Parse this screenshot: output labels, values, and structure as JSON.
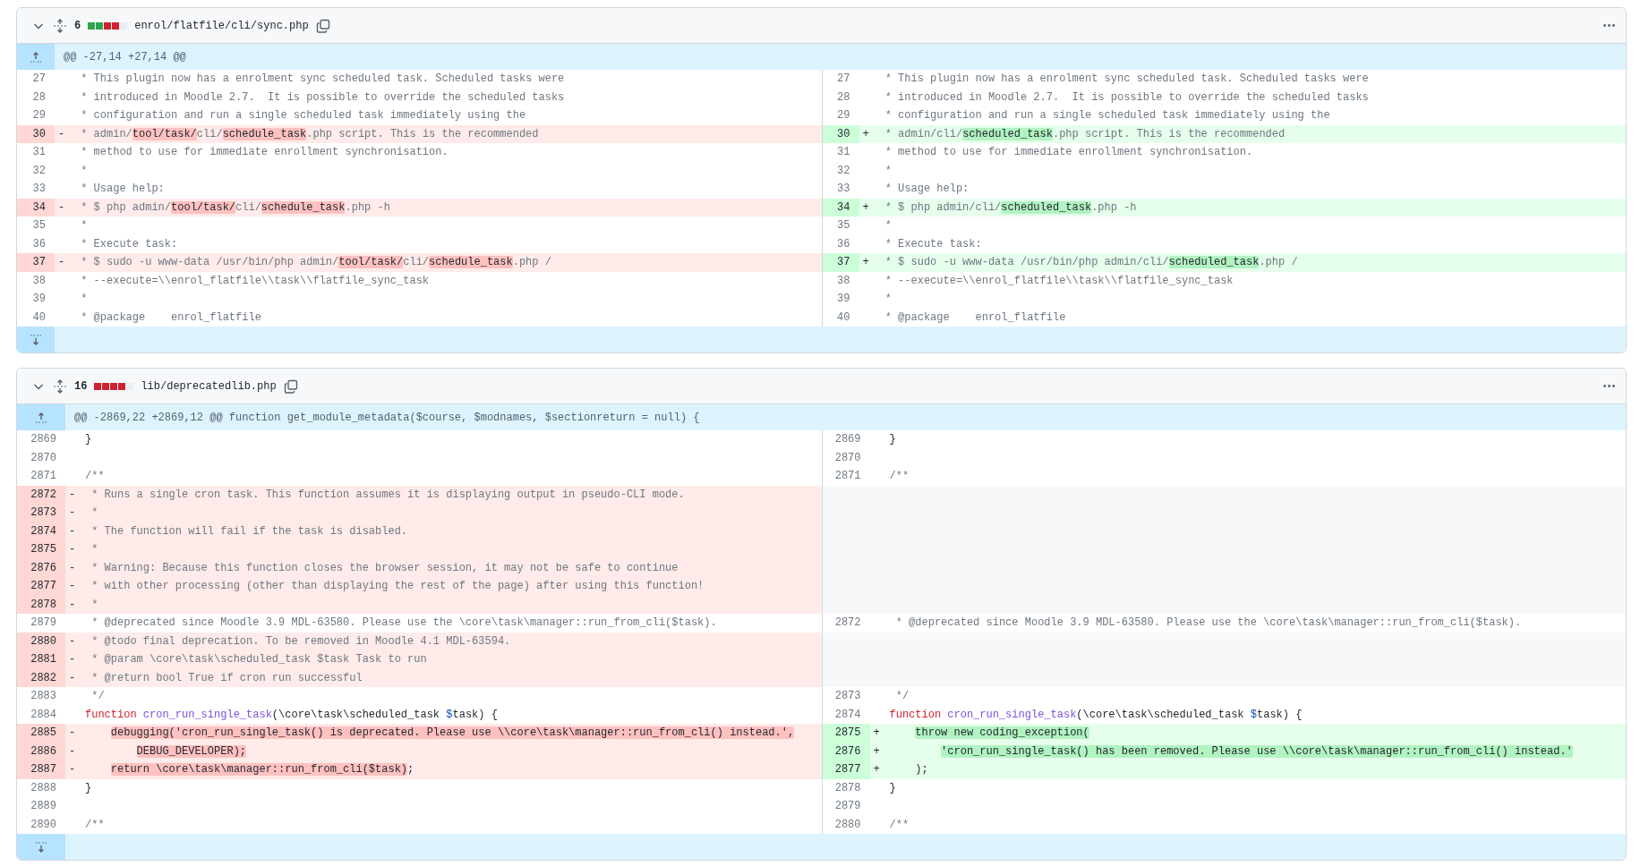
{
  "files": [
    {
      "expanded": true,
      "changes": "6",
      "diffstat": [
        {
          "color": "#2da44e"
        },
        {
          "color": "#2da44e"
        },
        {
          "color": "#cf222e"
        },
        {
          "color": "#cf222e"
        },
        {
          "color": "#eaeef2"
        }
      ],
      "path": "enrol/flatfile/cli/sync.php",
      "hunk": "@@ -27,14 +27,14 @@",
      "rows": [
        {
          "left": {
            "kind": "context",
            "num": "27",
            "segs": [
              {
                "text": " * This plugin now has a enrolment sync scheduled task. Scheduled tasks were",
                "kind": "comment",
                "highlight": false
              }
            ]
          },
          "right": {
            "kind": "context",
            "num": "27",
            "segs": [
              {
                "text": " * This plugin now has a enrolment sync scheduled task. Scheduled tasks were",
                "kind": "comment",
                "highlight": false
              }
            ]
          }
        },
        {
          "left": {
            "kind": "context",
            "num": "28",
            "segs": [
              {
                "text": " * introduced in Moodle 2.7.  It is possible to override the scheduled tasks",
                "kind": "comment",
                "highlight": false
              }
            ]
          },
          "right": {
            "kind": "context",
            "num": "28",
            "segs": [
              {
                "text": " * introduced in Moodle 2.7.  It is possible to override the scheduled tasks",
                "kind": "comment",
                "highlight": false
              }
            ]
          }
        },
        {
          "left": {
            "kind": "context",
            "num": "29",
            "segs": [
              {
                "text": " * configuration and run a single scheduled task immediately using the",
                "kind": "comment",
                "highlight": false
              }
            ]
          },
          "right": {
            "kind": "context",
            "num": "29",
            "segs": [
              {
                "text": " * configuration and run a single scheduled task immediately using the",
                "kind": "comment",
                "highlight": false
              }
            ]
          }
        },
        {
          "left": {
            "kind": "deletion",
            "num": "30",
            "marker": "-",
            "segs": [
              {
                "text": " * admin/",
                "kind": "comment",
                "highlight": false
              },
              {
                "text": "tool/task/",
                "kind": "comment",
                "highlight": true
              },
              {
                "text": "cli/",
                "kind": "comment",
                "highlight": false
              },
              {
                "text": "schedule_task",
                "kind": "comment",
                "highlight": true
              },
              {
                "text": ".php script. This is the recommended",
                "kind": "comment",
                "highlight": false
              }
            ]
          },
          "right": {
            "kind": "addition",
            "num": "30",
            "marker": "+",
            "segs": [
              {
                "text": " * admin/cli/",
                "kind": "comment",
                "highlight": false
              },
              {
                "text": "scheduled_task",
                "kind": "comment",
                "highlight": true
              },
              {
                "text": ".php script. This is the recommended",
                "kind": "comment",
                "highlight": false
              }
            ]
          }
        },
        {
          "left": {
            "kind": "context",
            "num": "31",
            "segs": [
              {
                "text": " * method to use for immediate enrollment synchronisation.",
                "kind": "comment",
                "highlight": false
              }
            ]
          },
          "right": {
            "kind": "context",
            "num": "31",
            "segs": [
              {
                "text": " * method to use for immediate enrollment synchronisation.",
                "kind": "comment",
                "highlight": false
              }
            ]
          }
        },
        {
          "left": {
            "kind": "context",
            "num": "32",
            "segs": [
              {
                "text": " *",
                "kind": "comment",
                "highlight": false
              }
            ]
          },
          "right": {
            "kind": "context",
            "num": "32",
            "segs": [
              {
                "text": " *",
                "kind": "comment",
                "highlight": false
              }
            ]
          }
        },
        {
          "left": {
            "kind": "context",
            "num": "33",
            "segs": [
              {
                "text": " * Usage help:",
                "kind": "comment",
                "highlight": false
              }
            ]
          },
          "right": {
            "kind": "context",
            "num": "33",
            "segs": [
              {
                "text": " * Usage help:",
                "kind": "comment",
                "highlight": false
              }
            ]
          }
        },
        {
          "left": {
            "kind": "deletion",
            "num": "34",
            "marker": "-",
            "segs": [
              {
                "text": " * $ php admin/",
                "kind": "comment",
                "highlight": false
              },
              {
                "text": "tool/task/",
                "kind": "comment",
                "highlight": true
              },
              {
                "text": "cli/",
                "kind": "comment",
                "highlight": false
              },
              {
                "text": "schedule_task",
                "kind": "comment",
                "highlight": true
              },
              {
                "text": ".php -h",
                "kind": "comment",
                "highlight": false
              }
            ]
          },
          "right": {
            "kind": "addition",
            "num": "34",
            "marker": "+",
            "segs": [
              {
                "text": " * $ php admin/cli/",
                "kind": "comment",
                "highlight": false
              },
              {
                "text": "scheduled_task",
                "kind": "comment",
                "highlight": true
              },
              {
                "text": ".php -h",
                "kind": "comment",
                "highlight": false
              }
            ]
          }
        },
        {
          "left": {
            "kind": "context",
            "num": "35",
            "segs": [
              {
                "text": " *",
                "kind": "comment",
                "highlight": false
              }
            ]
          },
          "right": {
            "kind": "context",
            "num": "35",
            "segs": [
              {
                "text": " *",
                "kind": "comment",
                "highlight": false
              }
            ]
          }
        },
        {
          "left": {
            "kind": "context",
            "num": "36",
            "segs": [
              {
                "text": " * Execute task:",
                "kind": "comment",
                "highlight": false
              }
            ]
          },
          "right": {
            "kind": "context",
            "num": "36",
            "segs": [
              {
                "text": " * Execute task:",
                "kind": "comment",
                "highlight": false
              }
            ]
          }
        },
        {
          "left": {
            "kind": "deletion",
            "num": "37",
            "marker": "-",
            "segs": [
              {
                "text": " * $ sudo -u www-data /usr/bin/php admin/",
                "kind": "comment",
                "highlight": false
              },
              {
                "text": "tool/task/",
                "kind": "comment",
                "highlight": true
              },
              {
                "text": "cli/",
                "kind": "comment",
                "highlight": false
              },
              {
                "text": "schedule_task",
                "kind": "comment",
                "highlight": true
              },
              {
                "text": ".php /",
                "kind": "comment",
                "highlight": false
              }
            ]
          },
          "right": {
            "kind": "addition",
            "num": "37",
            "marker": "+",
            "segs": [
              {
                "text": " * $ sudo -u www-data /usr/bin/php admin/cli/",
                "kind": "comment",
                "highlight": false
              },
              {
                "text": "scheduled_task",
                "kind": "comment",
                "highlight": true
              },
              {
                "text": ".php /",
                "kind": "comment",
                "highlight": false
              }
            ]
          }
        },
        {
          "left": {
            "kind": "context",
            "num": "38",
            "segs": [
              {
                "text": " * --execute=\\\\enrol_flatfile\\\\task\\\\flatfile_sync_task",
                "kind": "comment",
                "highlight": false
              }
            ]
          },
          "right": {
            "kind": "context",
            "num": "38",
            "segs": [
              {
                "text": " * --execute=\\\\enrol_flatfile\\\\task\\\\flatfile_sync_task",
                "kind": "comment",
                "highlight": false
              }
            ]
          }
        },
        {
          "left": {
            "kind": "context",
            "num": "39",
            "segs": [
              {
                "text": " *",
                "kind": "comment",
                "highlight": false
              }
            ]
          },
          "right": {
            "kind": "context",
            "num": "39",
            "segs": [
              {
                "text": " *",
                "kind": "comment",
                "highlight": false
              }
            ]
          }
        },
        {
          "left": {
            "kind": "context",
            "num": "40",
            "segs": [
              {
                "text": " * @package    enrol_flatfile",
                "kind": "comment",
                "highlight": false
              }
            ]
          },
          "right": {
            "kind": "context",
            "num": "40",
            "segs": [
              {
                "text": " * @package    enrol_flatfile",
                "kind": "comment",
                "highlight": false
              }
            ]
          }
        }
      ]
    },
    {
      "expanded": true,
      "changes": "16",
      "diffstat": [
        {
          "color": "#cf222e"
        },
        {
          "color": "#cf222e"
        },
        {
          "color": "#cf222e"
        },
        {
          "color": "#cf222e"
        },
        {
          "color": "#eaeef2"
        }
      ],
      "path": "lib/deprecatedlib.php",
      "hunk": "@@ -2869,22 +2869,12 @@ function get_module_metadata($course, $modnames, $sectionreturn = null) {",
      "rows": [
        {
          "left": {
            "kind": "context",
            "num": "2869",
            "segs": [
              {
                "text": "}",
                "kind": "plain",
                "highlight": false
              }
            ]
          },
          "right": {
            "kind": "context",
            "num": "2869",
            "segs": [
              {
                "text": "}",
                "kind": "plain",
                "highlight": false
              }
            ]
          }
        },
        {
          "left": {
            "kind": "context",
            "num": "2870"
          },
          "right": {
            "kind": "context",
            "num": "2870"
          }
        },
        {
          "left": {
            "kind": "context",
            "num": "2871",
            "segs": [
              {
                "text": "/**",
                "kind": "comment",
                "highlight": false
              }
            ]
          },
          "right": {
            "kind": "context",
            "num": "2871",
            "segs": [
              {
                "text": "/**",
                "kind": "comment",
                "highlight": false
              }
            ]
          }
        },
        {
          "left": {
            "kind": "deletion",
            "num": "2872",
            "marker": "-",
            "segs": [
              {
                "text": " * Runs a single cron task. This function assumes it is displaying output in pseudo-CLI mode.",
                "kind": "comment",
                "highlight": false
              }
            ]
          },
          "right": {
            "kind": "empty"
          }
        },
        {
          "left": {
            "kind": "deletion",
            "num": "2873",
            "marker": "-",
            "segs": [
              {
                "text": " *",
                "kind": "comment",
                "highlight": false
              }
            ]
          },
          "right": {
            "kind": "empty"
          }
        },
        {
          "left": {
            "kind": "deletion",
            "num": "2874",
            "marker": "-",
            "segs": [
              {
                "text": " * The function will fail if the task is disabled.",
                "kind": "comment",
                "highlight": false
              }
            ]
          },
          "right": {
            "kind": "empty"
          }
        },
        {
          "left": {
            "kind": "deletion",
            "num": "2875",
            "marker": "-",
            "segs": [
              {
                "text": " *",
                "kind": "comment",
                "highlight": false
              }
            ]
          },
          "right": {
            "kind": "empty"
          }
        },
        {
          "left": {
            "kind": "deletion",
            "num": "2876",
            "marker": "-",
            "segs": [
              {
                "text": " * Warning: Because this function closes the browser session, it may not be safe to continue",
                "kind": "comment",
                "highlight": false
              }
            ]
          },
          "right": {
            "kind": "empty"
          }
        },
        {
          "left": {
            "kind": "deletion",
            "num": "2877",
            "marker": "-",
            "segs": [
              {
                "text": " * with other processing (other than displaying the rest of the page) after using this function!",
                "kind": "comment",
                "highlight": false
              }
            ]
          },
          "right": {
            "kind": "empty"
          }
        },
        {
          "left": {
            "kind": "deletion",
            "num": "2878",
            "marker": "-",
            "segs": [
              {
                "text": " *",
                "kind": "comment",
                "highlight": false
              }
            ]
          },
          "right": {
            "kind": "empty"
          }
        },
        {
          "left": {
            "kind": "context",
            "num": "2879",
            "segs": [
              {
                "text": " * @deprecated since Moodle 3.9 MDL-63580. Please use the \\core\\task\\manager::run_from_cli($task).",
                "kind": "comment",
                "highlight": false
              }
            ]
          },
          "right": {
            "kind": "context",
            "num": "2872",
            "segs": [
              {
                "text": " * @deprecated since Moodle 3.9 MDL-63580. Please use the \\core\\task\\manager::run_from_cli($task).",
                "kind": "comment",
                "highlight": false
              }
            ]
          }
        },
        {
          "left": {
            "kind": "deletion",
            "num": "2880",
            "marker": "-",
            "segs": [
              {
                "text": " * @todo final deprecation. To be removed in Moodle 4.1 MDL-63594.",
                "kind": "comment",
                "highlight": false
              }
            ]
          },
          "right": {
            "kind": "empty"
          }
        },
        {
          "left": {
            "kind": "deletion",
            "num": "2881",
            "marker": "-",
            "segs": [
              {
                "text": " * @param \\core\\task\\scheduled_task $task Task to run",
                "kind": "comment",
                "highlight": false
              }
            ]
          },
          "right": {
            "kind": "empty"
          }
        },
        {
          "left": {
            "kind": "deletion",
            "num": "2882",
            "marker": "-",
            "segs": [
              {
                "text": " * @return bool True if cron run successful",
                "kind": "comment",
                "highlight": false
              }
            ]
          },
          "right": {
            "kind": "empty"
          }
        },
        {
          "left": {
            "kind": "context",
            "num": "2883",
            "segs": [
              {
                "text": " */",
                "kind": "comment",
                "highlight": false
              }
            ]
          },
          "right": {
            "kind": "context",
            "num": "2873",
            "segs": [
              {
                "text": " */",
                "kind": "comment",
                "highlight": false
              }
            ]
          }
        },
        {
          "left": {
            "kind": "context",
            "num": "2884",
            "segs": [
              {
                "text": "function ",
                "kind": "keyword",
                "highlight": false
              },
              {
                "text": "cron_run_single_task",
                "kind": "entity",
                "highlight": false
              },
              {
                "text": "(\\core\\task\\scheduled_task ",
                "kind": "plain",
                "highlight": false
              },
              {
                "text": "$",
                "kind": "variable",
                "highlight": false
              },
              {
                "text": "task) {",
                "kind": "plain",
                "highlight": false
              }
            ]
          },
          "right": {
            "kind": "context",
            "num": "2874",
            "segs": [
              {
                "text": "function ",
                "kind": "keyword",
                "highlight": false
              },
              {
                "text": "cron_run_single_task",
                "kind": "entity",
                "highlight": false
              },
              {
                "text": "(\\core\\task\\scheduled_task ",
                "kind": "plain",
                "highlight": false
              },
              {
                "text": "$",
                "kind": "variable",
                "highlight": false
              },
              {
                "text": "task) {",
                "kind": "plain",
                "highlight": false
              }
            ]
          }
        },
        {
          "left": {
            "kind": "deletion",
            "num": "2885",
            "marker": "-",
            "segs": [
              {
                "text": "    debugging('cron_run_single_task() is deprecated. Please use \\\\core\\task\\manager::run_from_cli() instead.',",
                "kind": "plain",
                "highlight": true
              }
            ]
          },
          "right": {
            "kind": "addition",
            "num": "2875",
            "marker": "+",
            "segs": [
              {
                "text": "    throw new coding_exception(",
                "kind": "plain",
                "highlight": true
              }
            ]
          }
        },
        {
          "left": {
            "kind": "deletion",
            "num": "2886",
            "marker": "-",
            "segs": [
              {
                "text": "        DEBUG_DEVELOPER);",
                "kind": "plain",
                "highlight": true
              }
            ]
          },
          "right": {
            "kind": "addition",
            "num": "2876",
            "marker": "+",
            "segs": [
              {
                "text": "        'cron_run_single_task() has been removed. Please use \\\\core\\task\\manager::run_from_cli() instead.'",
                "kind": "plain",
                "highlight": true
              }
            ]
          }
        },
        {
          "left": {
            "kind": "deletion",
            "num": "2887",
            "marker": "-",
            "segs": [
              {
                "text": "    return \\core\\task\\manager::run_from_cli($task)",
                "kind": "plain",
                "highlight": true
              },
              {
                "text": ";",
                "kind": "plain",
                "highlight": false
              }
            ]
          },
          "right": {
            "kind": "addition",
            "num": "2877",
            "marker": "+",
            "segs": [
              {
                "text": "    );",
                "kind": "plain",
                "highlight": false
              }
            ]
          }
        },
        {
          "left": {
            "kind": "context",
            "num": "2888",
            "segs": [
              {
                "text": "}",
                "kind": "plain",
                "highlight": false
              }
            ]
          },
          "right": {
            "kind": "context",
            "num": "2878",
            "segs": [
              {
                "text": "}",
                "kind": "plain",
                "highlight": false
              }
            ]
          }
        },
        {
          "left": {
            "kind": "context",
            "num": "2889"
          },
          "right": {
            "kind": "context",
            "num": "2879"
          }
        },
        {
          "left": {
            "kind": "context",
            "num": "2890",
            "segs": [
              {
                "text": "/**",
                "kind": "comment",
                "highlight": false
              }
            ]
          },
          "right": {
            "kind": "context",
            "num": "2880",
            "segs": [
              {
                "text": "/**",
                "kind": "comment",
                "highlight": false
              }
            ]
          }
        }
      ]
    }
  ]
}
